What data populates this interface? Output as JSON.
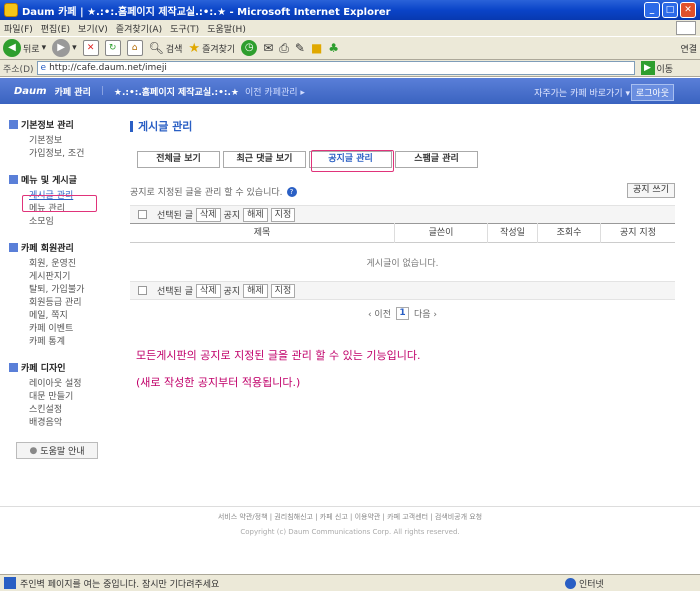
{
  "window": {
    "title": "Daum 카페 | ★.:•:.홈페이지 제작교실.:•:.★ - Microsoft Internet Explorer"
  },
  "menu": {
    "file": "파일(F)",
    "edit": "편집(E)",
    "view": "보기(V)",
    "favorites": "즐겨찾기(A)",
    "tools": "도구(T)",
    "help": "도움말(H)"
  },
  "toolbar": {
    "back": "뒤로",
    "search": "검색",
    "favorites": "즐겨찾기",
    "links": "연결"
  },
  "address": {
    "label": "주소(D)",
    "url": "http://cafe.daum.net/imeji",
    "go": "이동"
  },
  "cafe": {
    "logo": "Daum",
    "mgr": "카페 관리",
    "name": "★.:•:.홈페이지 제작교실.:•:.★",
    "prev": "이전 카페관리 ▸",
    "goto": "자주가는 카페 바로가기 ▾",
    "logout": "로그아웃"
  },
  "sidebar": {
    "groups": [
      {
        "title": "기본정보 관리",
        "items": [
          "기본정보",
          "가입정보, 조건"
        ]
      },
      {
        "title": "메뉴 및 게시글",
        "items": [
          "게시글 관리",
          "메뉴 관리",
          "소모임"
        ]
      },
      {
        "title": "카페 회원관리",
        "items": [
          "회원, 운영진",
          "게시판지기",
          "탈퇴, 가입불가",
          "회원등급 관리",
          "메일, 쪽지",
          "카페 이벤트",
          "카페 통계"
        ]
      },
      {
        "title": "카페 디자인",
        "items": [
          "레이아웃 설정",
          "대문 만들기",
          "스킨설정",
          "배경음악"
        ]
      }
    ],
    "help": "도움말 안내"
  },
  "content": {
    "title": "게시글 관리",
    "tabs": [
      "전체글 보기",
      "최근 댓글 보기",
      "공지글 관리",
      "스팸글 관리"
    ],
    "desc": "공지로 지정된 글을 관리 할 수 있습니다.",
    "write": "공지 쓰기",
    "actions": {
      "selected": "선택된 글",
      "delete": "삭제",
      "notice": "공지",
      "release": "해제",
      "assign": "지정"
    },
    "columns": [
      "제목",
      "글쓴이",
      "작성일",
      "조회수",
      "공지 지정"
    ],
    "empty": "게시글이 없습니다.",
    "pager": {
      "prev": "‹ 이전",
      "page": "1",
      "next": "다음 ›"
    },
    "note1": "모든게시판의 공지로 지정된 글을 관리 할 수 있는 기능입니다.",
    "note2": "(새로 작성한 공지부터 적용됩니다.)"
  },
  "footer": {
    "links": "서비스 약관/정책  |  권리침해신고  |  카페 신고  |  이용약관  |  카페 고객센터  |  검색비공개 요청",
    "copy": "Copyright (c) Daum Communications Corp. All rights reserved."
  },
  "status": {
    "text": "주인벽 페이지를 여는 중입니다. 잠시만 기다려주세요",
    "zone": "인터넷"
  }
}
